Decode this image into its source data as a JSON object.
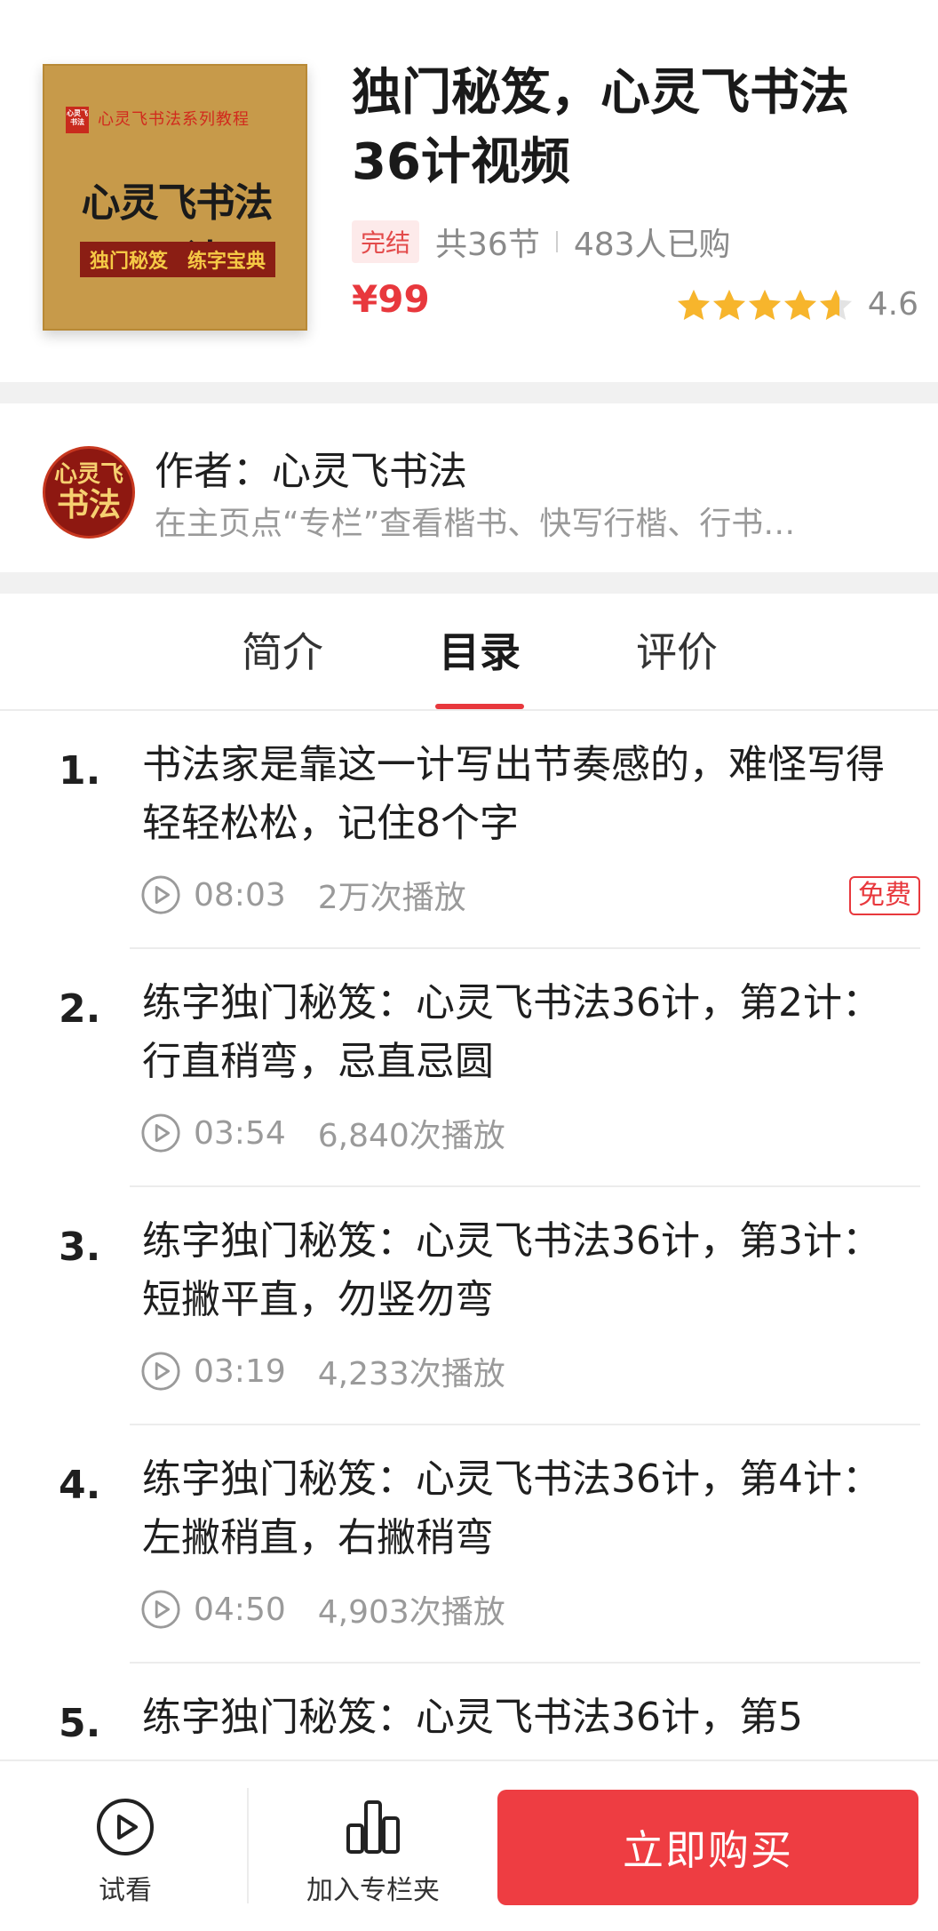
{
  "product": {
    "cover": {
      "seal_text": "心灵飞书法",
      "series_text": "心灵飞书法系列教程",
      "title": "心灵飞书法36计",
      "band_left": "独门秘笈",
      "band_right": "练字宝典"
    },
    "title": "独门秘笈，心灵飞书法36计视频",
    "status_badge": "完结",
    "lesson_count": "共36节",
    "buyers": "483人已购",
    "price": "¥99",
    "rating": 4.6,
    "rating_text": "4.6"
  },
  "author": {
    "avatar_line1": "心灵飞",
    "avatar_line2": "书法",
    "name": "作者：心灵飞书法",
    "description": "在主页点“专栏”查看楷书、快写行楷、行书…"
  },
  "tabs": [
    {
      "label": "简介",
      "active": false
    },
    {
      "label": "目录",
      "active": true
    },
    {
      "label": "评价",
      "active": false
    }
  ],
  "lessons": [
    {
      "num": "1.",
      "title": "书法家是靠这一计写出节奏感的，难怪写得轻轻松松，记住8个字",
      "duration": "08:03",
      "plays": "2万次播放",
      "free_badge": "免费"
    },
    {
      "num": "2.",
      "title": "练字独门秘笈：心灵飞书法36计，第2计：行直稍弯，忌直忌圆",
      "duration": "03:54",
      "plays": "6,840次播放"
    },
    {
      "num": "3.",
      "title": "练字独门秘笈：心灵飞书法36计，第3计：短撇平直，勿竖勿弯",
      "duration": "03:19",
      "plays": "4,233次播放"
    },
    {
      "num": "4.",
      "title": "练字独门秘笈：心灵飞书法36计，第4计：左撇稍直，右撇稍弯",
      "duration": "04:50",
      "plays": "4,903次播放"
    },
    {
      "num": "5.",
      "title": "练字独门秘笈：心灵飞书法36计，第5",
      "duration": "",
      "plays": ""
    }
  ],
  "bottom_bar": {
    "trial_label": "试看",
    "favorite_label": "加入专栏夹",
    "buy_label": "立即购买"
  },
  "colors": {
    "accent": "#e8383d",
    "star": "#f7b52c",
    "muted": "#9a9a9a"
  }
}
